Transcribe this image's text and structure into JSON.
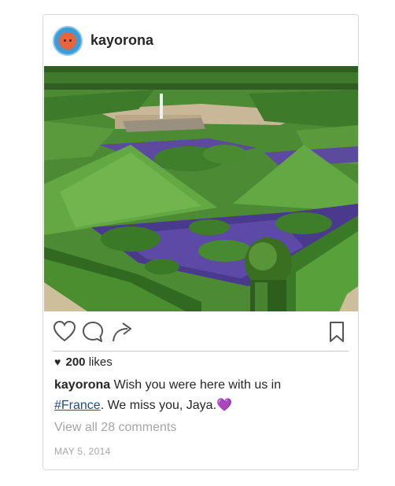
{
  "post": {
    "username": "kayorona",
    "likes": {
      "count": "200",
      "suffix": "likes",
      "heart_icon": "heart-filled-icon"
    },
    "caption": {
      "username": "kayorona",
      "text_before": " Wish you were here with us in",
      "hashtag": "#France",
      "text_after": ". We miss you, Jaya.",
      "emoji": "💜"
    },
    "view_comments": "View all 28 comments",
    "date": "MAY 5, 2014"
  },
  "icons": {
    "like": "heart-outline-icon",
    "comment": "comment-bubble-icon",
    "share": "share-arrow-icon",
    "save": "bookmark-icon"
  },
  "colors": {
    "text": "#262626",
    "muted": "#a5a5a5",
    "hashtag": "#1f4f7a",
    "purple_heart": "#8a5fd6"
  }
}
